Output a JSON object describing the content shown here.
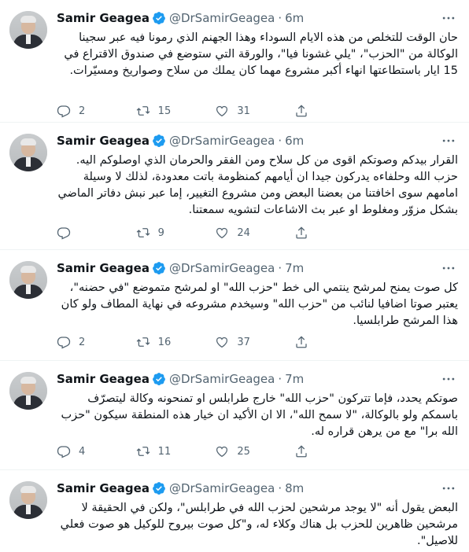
{
  "tweets": [
    {
      "author": "Samir Geagea",
      "handle": "@DrSamirGeagea",
      "time": "6m",
      "text": "حان الوقت للتخلص من هذه الايام السوداء وهذا الجهنم الذي رمونا فيه عبر سجينا الوكالة من \"الحزب\"، \"يلي غشونا فيا\"، والورقة التي ستوضع في صندوق الاقتراع في 15 ايار باستطاعتها انهاء أكبر مشروع مهما كان يملك من سلاح وصواريخ ومسيّرات.",
      "replies": "2",
      "retweets": "15",
      "likes": "31"
    },
    {
      "author": "Samir Geagea",
      "handle": "@DrSamirGeagea",
      "time": "6m",
      "text": "القرار بيدكم وصوتكم اقوى من كل سلاح ومن الفقر والحرمان الذي اوصلوكم اليه. حزب الله وحلفاءه يدركون جيدا ان أيامهم كمنظومة باتت معدودة، لذلك لا وسيلة امامهم سوى اخافتنا من بعضنا البعض ومن مشروع التغيير، إما عبر نبش دفاتر الماضي بشكل مزوّر ومغلوط او عبر بث الاشاعات لتشويه سمعتنا.",
      "replies": "",
      "retweets": "9",
      "likes": "24"
    },
    {
      "author": "Samir Geagea",
      "handle": "@DrSamirGeagea",
      "time": "7m",
      "text": "كل صوت يمنح لمرشح ينتمي الى خط \"حزب الله\" او لمرشح متموضع \"في حضنه\"، يعتبر صوتا اضافيا لنائب من \"حزب الله\" وسيخدم مشروعه في نهاية المطاف ولو كان هذا المرشح طرابلسيا.",
      "replies": "2",
      "retweets": "16",
      "likes": "37"
    },
    {
      "author": "Samir Geagea",
      "handle": "@DrSamirGeagea",
      "time": "7m",
      "text": "صوتكم يحدد، فإما تتركون \"حزب الله\" خارج طرابلس او تمنحونه وكالة ليتصرّف باسمكم ولو بالوكالة، \"لا سمح الله\"، الا ان الأكيد ان خيار هذه المنطقة سيكون \"حزب الله برا\" مع من يرهن قراره له.",
      "replies": "4",
      "retweets": "11",
      "likes": "25"
    },
    {
      "author": "Samir Geagea",
      "handle": "@DrSamirGeagea",
      "time": "8m",
      "text": "البعض يقول أنه \"لا يوجد مرشحين لحزب الله في طرابلس\"، ولكن في الحقيقة لا مرشحين ظاهرين للحزب بل هناك وكلاء له، و\"كل صوت بيروح للوكيل هو صوت فعلي للاصيل\".",
      "replies": "",
      "retweets": "",
      "likes": ""
    }
  ],
  "icons": {
    "verified": "verified-badge-icon",
    "more": "more-options-icon",
    "reply": "reply-icon",
    "retweet": "retweet-icon",
    "like": "like-icon",
    "share": "share-icon"
  },
  "colors": {
    "accent": "#1d9bf0",
    "muted": "#536471",
    "text": "#0f1419",
    "divider": "#eff3f4"
  }
}
